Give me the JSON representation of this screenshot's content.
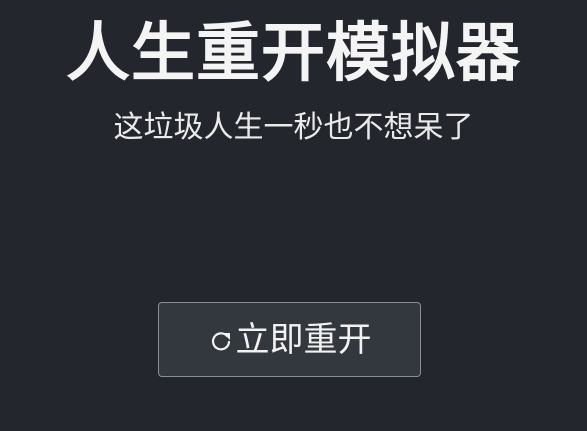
{
  "header": {
    "title": "人生重开模拟器",
    "subtitle": "这垃圾人生一秒也不想呆了"
  },
  "actions": {
    "restart_label": "立即重开",
    "restart_icon": "refresh-icon"
  },
  "colors": {
    "background": "#23262c",
    "button_background": "#33373e",
    "button_border": "#8a8e96",
    "text": "#f2f2f2"
  }
}
